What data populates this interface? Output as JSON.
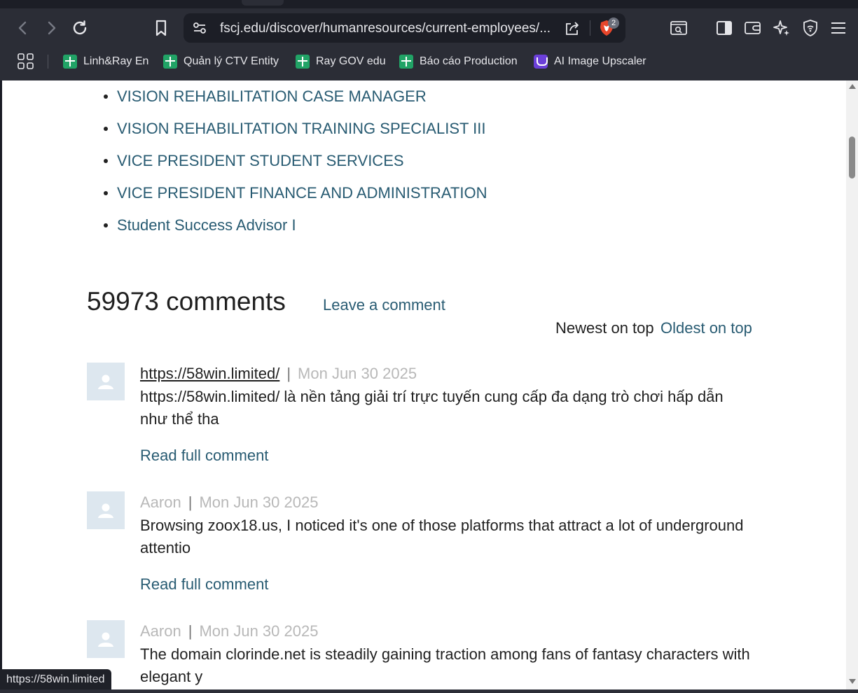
{
  "browser": {
    "url": "fscj.edu/discover/humanresources/current-employees/...",
    "brave_badge_count": "2",
    "bookmarks": [
      {
        "label": "Linh&Ray En",
        "icon": "spreadsheet-icon"
      },
      {
        "label": "Quản lý CTV Entity",
        "icon": "spreadsheet-icon"
      },
      {
        "label": "Ray GOV edu",
        "icon": "spreadsheet-icon"
      },
      {
        "label": "Báo cáo Production",
        "icon": "spreadsheet-icon"
      },
      {
        "label": "AI Image Upscaler",
        "icon": "upscaler-app-icon"
      }
    ],
    "status_url": "https://58win.limited"
  },
  "page": {
    "job_links": [
      "VISION REHABILITATION CASE MANAGER",
      "VISION REHABILITATION TRAINING SPECIALIST III",
      "VICE PRESIDENT STUDENT SERVICES",
      "VICE PRESIDENT FINANCE AND ADMINISTRATION",
      "Student Success Advisor I"
    ],
    "comments_count": "59973 comments",
    "leave_comment": "Leave a comment",
    "sort": {
      "newest": "Newest on top",
      "oldest": "Oldest on top"
    },
    "comments": [
      {
        "author": "https://58win.limited/",
        "date": "Mon Jun 30 2025",
        "text": "https://58win.limited/ là nền tảng giải trí trực tuyến cung cấp đa dạng trò chơi hấp dẫn như thể tha",
        "read_more": "Read full comment"
      },
      {
        "author": "Aaron",
        "date": "Mon Jun 30 2025",
        "text": "Browsing zoox18.us, I noticed it's one of those platforms that attract a lot of underground attentio",
        "read_more": "Read full comment"
      },
      {
        "author": "Aaron",
        "date": "Mon Jun 30 2025",
        "text": "The domain clorinde.net is steadily gaining traction among fans of fantasy characters with elegant y"
      }
    ]
  },
  "colors": {
    "link": "#285b72",
    "text": "#1f1f1f",
    "muted": "#b8b8b8",
    "avatar_bg": "#dde7ef",
    "chrome_bg": "#2b2d36"
  }
}
